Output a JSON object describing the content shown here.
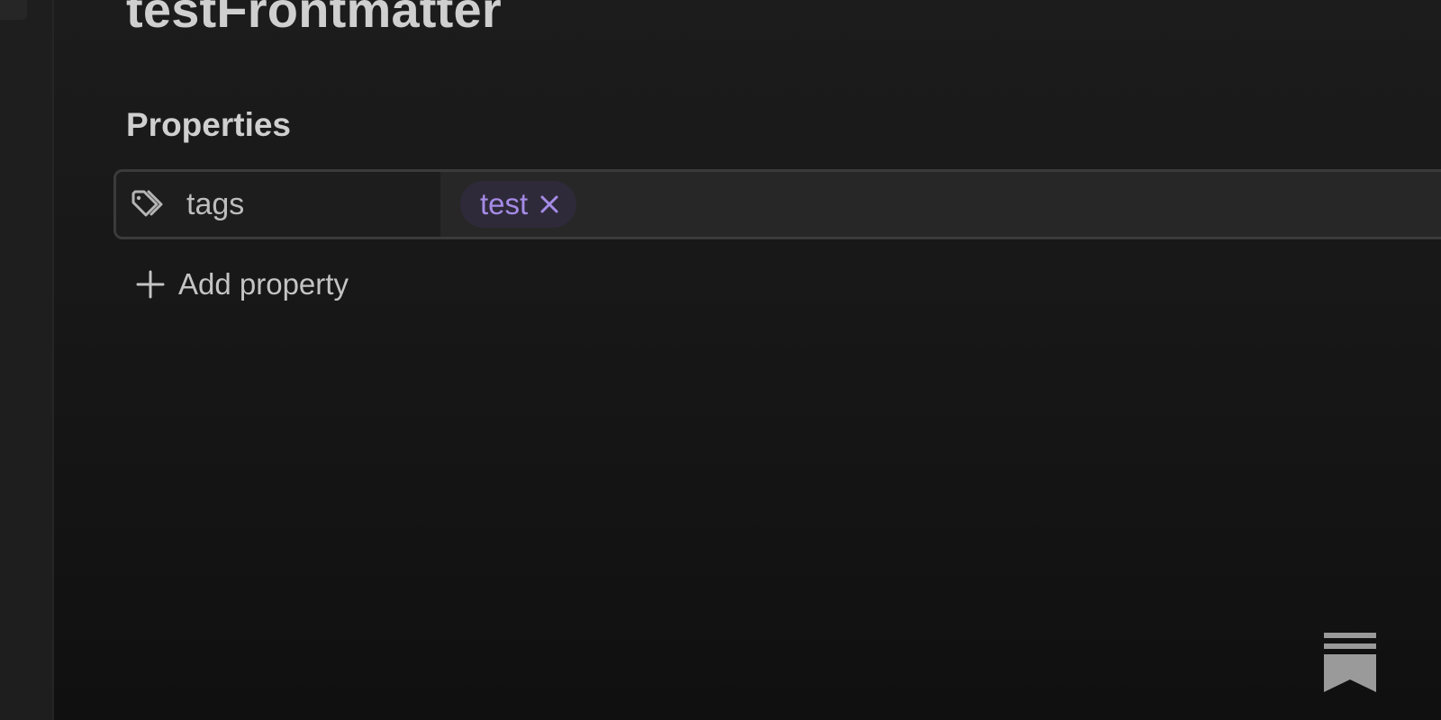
{
  "note": {
    "title": "testFrontmatter"
  },
  "properties": {
    "heading": "Properties",
    "rows": [
      {
        "key": "tags",
        "icon": "tags-icon",
        "values": [
          "test"
        ]
      }
    ],
    "add_label": "Add property",
    "add_icon": "plus-icon"
  },
  "theme": {
    "background": "#1a1a1a",
    "tag_text": "#a58be6",
    "tag_background": "#2f2a3a",
    "row_border": "#3b3b3b"
  },
  "corner_icon": "bookmark-ribbon-icon"
}
